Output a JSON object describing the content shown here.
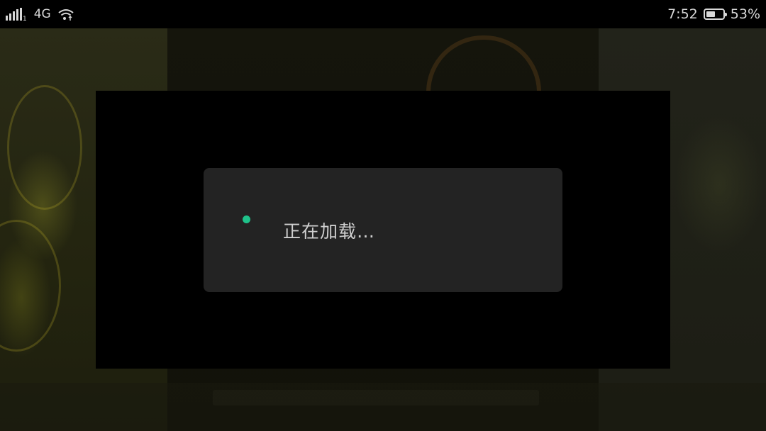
{
  "status_bar": {
    "network_type": "4G",
    "signal_sub": "1",
    "time": "7:52",
    "battery_percent": "53%",
    "battery_level": 0.53,
    "icons": [
      "signal-icon",
      "wifi-icon",
      "battery-icon"
    ]
  },
  "dialog": {
    "loading_text": "正在加载…",
    "spinner_color": "#1fc28a"
  }
}
